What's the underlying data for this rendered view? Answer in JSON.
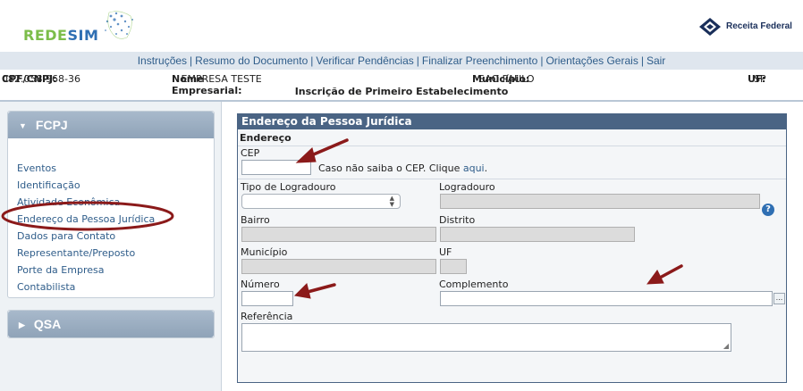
{
  "header": {
    "logo_part1": "REDE",
    "logo_part2": "SIM",
    "agency_logo": "Receita Federal"
  },
  "topnav": {
    "items": [
      "Instruções",
      "Resumo do Documento",
      "Verificar Pendências",
      "Finalizar Preenchimento",
      "Orientações Gerais",
      "Sair"
    ],
    "separator": "|"
  },
  "info": {
    "cpf_label": "CPF/CNPJ:",
    "cpf_value": "082.058.968-36",
    "nome_label": "Nome Empresarial:",
    "nome_value": "EMPRESA TESTE",
    "mun_label": "Município:",
    "mun_value": "SAO PAULO",
    "uf_label": "UF:",
    "uf_value": "SP",
    "inscricao": "Inscrição de Primeiro Estabelecimento"
  },
  "sidebar": {
    "fcpj_title": "FCPJ",
    "qsa_title": "QSA",
    "items": [
      "Eventos",
      "Identificação",
      "Atividade Econômica",
      "Endereço da Pessoa Jurídica",
      "Dados para Contato",
      "Representante/Preposto",
      "Porte da Empresa",
      "Contabilista"
    ],
    "caret_open": "▼",
    "caret_closed": "▶"
  },
  "form": {
    "title": "Endereço da Pessoa Jurídica",
    "section": "Endereço",
    "cep_label": "CEP",
    "cep_value": "",
    "cep_hint": "Caso não saiba o CEP. Clique",
    "cep_link": "aqui",
    "cep_hint_end": ".",
    "tipo_label": "Tipo de Logradouro",
    "tipo_value": "",
    "logradouro_label": "Logradouro",
    "bairro_label": "Bairro",
    "distrito_label": "Distrito",
    "municipio_label": "Município",
    "uf_label": "UF",
    "numero_label": "Número",
    "numero_value": "",
    "complemento_label": "Complemento",
    "complemento_value": "",
    "referencia_label": "Referência",
    "referencia_value": "",
    "help_glyph": "?",
    "dots_glyph": "..."
  },
  "colors": {
    "accent": "#4a6484",
    "link": "#2f5d8a",
    "annotation": "#8b1a1a"
  }
}
